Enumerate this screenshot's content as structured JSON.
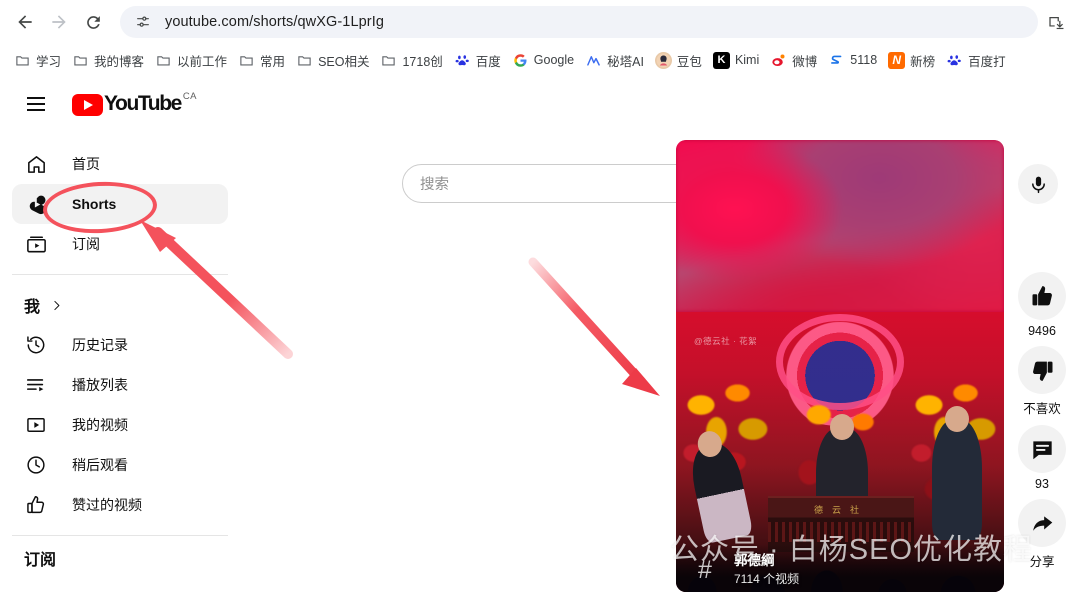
{
  "browser": {
    "back_icon": "back-arrow-icon",
    "forward_icon": "forward-arrow-icon",
    "reload_icon": "reload-icon",
    "site_settings_icon": "tune-icon",
    "url": "youtube.com/shorts/qwXG-1LprIg",
    "install_icon": "install-app-icon",
    "bookmarks": [
      {
        "label": "学习",
        "icon": "folder-icon",
        "type": "folder"
      },
      {
        "label": "我的博客",
        "icon": "folder-icon",
        "type": "folder"
      },
      {
        "label": "以前工作",
        "icon": "folder-icon",
        "type": "folder"
      },
      {
        "label": "常用",
        "icon": "folder-icon",
        "type": "folder"
      },
      {
        "label": "SEO相关",
        "icon": "folder-icon",
        "type": "folder"
      },
      {
        "label": "1718创",
        "icon": "folder-icon",
        "type": "folder"
      },
      {
        "label": "百度",
        "icon": "baidu-icon",
        "type": "site"
      },
      {
        "label": "Google",
        "icon": "google-icon",
        "type": "site"
      },
      {
        "label": "秘塔AI",
        "icon": "metaso-icon",
        "type": "site"
      },
      {
        "label": "豆包",
        "icon": "doubao-icon",
        "type": "site"
      },
      {
        "label": "Kimi",
        "icon": "kimi-icon",
        "type": "site",
        "glyph": "K"
      },
      {
        "label": "微博",
        "icon": "weibo-icon",
        "type": "site"
      },
      {
        "label": "5118",
        "icon": "5118-icon",
        "type": "site"
      },
      {
        "label": "新榜",
        "icon": "newrank-icon",
        "type": "site",
        "glyph": "N"
      },
      {
        "label": "百度打",
        "icon": "baidu-icon",
        "type": "site"
      }
    ]
  },
  "youtube": {
    "menu_icon": "hamburger-menu-icon",
    "logo_word": "YouTube",
    "logo_country": "CA",
    "search": {
      "placeholder": "搜索",
      "value": "",
      "search_icon": "search-icon",
      "mic_icon": "microphone-icon"
    },
    "sidebar": {
      "items": [
        {
          "label": "首页",
          "icon": "home-icon",
          "active": false
        },
        {
          "label": "Shorts",
          "icon": "shorts-icon",
          "active": true
        },
        {
          "label": "订阅",
          "icon": "subscriptions-icon",
          "active": false
        }
      ],
      "you_section": {
        "label": "我",
        "chevron_icon": "chevron-right-icon",
        "items": [
          {
            "label": "历史记录",
            "icon": "history-icon"
          },
          {
            "label": "播放列表",
            "icon": "playlist-icon"
          },
          {
            "label": "我的视频",
            "icon": "your-videos-icon"
          },
          {
            "label": "稍后观看",
            "icon": "watch-later-icon"
          },
          {
            "label": "赞过的视频",
            "icon": "liked-videos-icon"
          }
        ]
      },
      "subscriptions_heading": "订阅"
    },
    "player": {
      "source_watermark": "@德云社 · 花絮",
      "table_text": "德云社",
      "channel": {
        "hash_icon": "hashtag-icon",
        "name": "郭德綱",
        "video_count": "7114 个视频"
      }
    },
    "actions": [
      {
        "name": "like",
        "icon": "thumbs-up-icon",
        "label": "9496"
      },
      {
        "name": "dislike",
        "icon": "thumbs-down-icon",
        "label": "不喜欢"
      },
      {
        "name": "comments",
        "icon": "comment-icon",
        "label": "93"
      },
      {
        "name": "share",
        "icon": "share-icon",
        "label": "分享"
      }
    ]
  },
  "overlay_watermark": {
    "icon": "wechat-icon",
    "text": "公众号 · 白杨SEO优化教程"
  },
  "annotations": {
    "highlight_color": "#f4525c",
    "ellipse_target": "Shorts",
    "arrow_count": 2
  }
}
